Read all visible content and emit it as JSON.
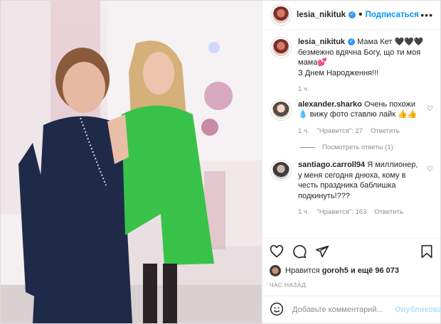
{
  "post": {
    "username": "lesia_nikituk",
    "follow_label": "Подписаться",
    "caption_line1": "Мама Кет 🖤🖤🖤",
    "caption_line2": "безмежно вдячна Богу, що ти моя мама💕",
    "caption_line3": "З Днем Народження!!!",
    "caption_time": "1 ч."
  },
  "comments": [
    {
      "username": "alexander.sharko",
      "text": "Очень похожи 💧 вижу фото ставлю лайк 👍👍",
      "time": "1 ч.",
      "likes": "\"Нравится\": 27",
      "reply_label": "Ответить"
    },
    {
      "username": "santiago.carroll94",
      "text": "Я миллионер, у меня сегодня днюха, кому в честь праздника баблишка подкинуть!???",
      "time": "1 ч.",
      "likes": "\"Нравится\": 163",
      "reply_label": "Ответить"
    }
  ],
  "view_replies": "Посмотреть ответы (1)",
  "likes_summary": {
    "prefix": "Нравится",
    "user": "goroh5",
    "suffix": "и ещё 96 073"
  },
  "timestamp": "ЧАС НАЗАД",
  "add_comment": {
    "placeholder": "Добавьте комментарий...",
    "publish_label": "Опубликовать"
  },
  "icons": [
    "heart-icon",
    "comment-icon",
    "share-icon",
    "bookmark-icon",
    "emoji-icon",
    "more-icon",
    "verified-icon"
  ],
  "colors": {
    "accent": "#0095f6",
    "verified": "#3897f0",
    "muted": "#8e8e8e",
    "jacket": "#39c24a",
    "dress": "#1f2a48"
  }
}
